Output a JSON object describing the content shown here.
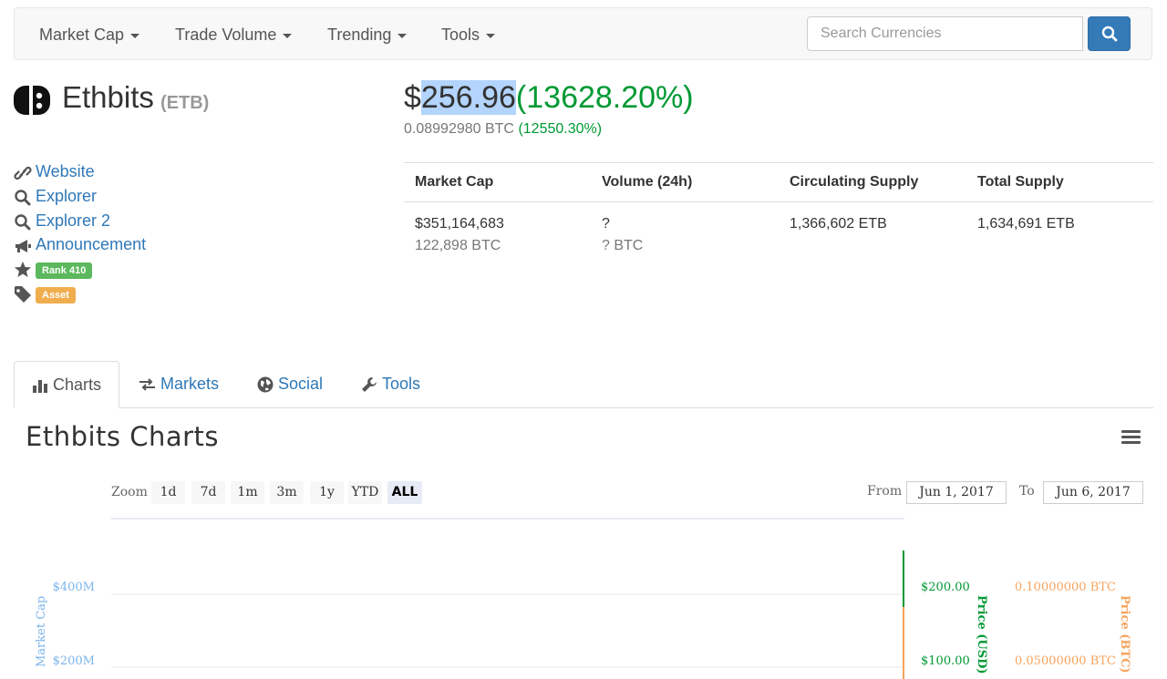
{
  "nav": {
    "items": [
      {
        "label": "Market Cap"
      },
      {
        "label": "Trade Volume"
      },
      {
        "label": "Trending"
      },
      {
        "label": "Tools"
      }
    ],
    "search_placeholder": "Search Currencies"
  },
  "coin": {
    "name": "Ethbits",
    "symbol": "(ETB)",
    "price_currency": "$",
    "price_usd": "256.96",
    "price_change": "(13628.20%)",
    "price_btc": "0.08992980 BTC",
    "price_btc_change": "(12550.30%)"
  },
  "links": [
    {
      "icon": "link-icon",
      "label": "Website"
    },
    {
      "icon": "search-icon",
      "label": "Explorer"
    },
    {
      "icon": "search-icon",
      "label": "Explorer 2"
    },
    {
      "icon": "bullhorn-icon",
      "label": "Announcement"
    }
  ],
  "badges": {
    "rank": {
      "icon": "star-icon",
      "label": "Rank 410",
      "color": "#5cb85c"
    },
    "type": {
      "icon": "tag-icon",
      "label": "Asset",
      "color": "#f0ad4e"
    }
  },
  "stats": {
    "headers": [
      "Market Cap",
      "Volume (24h)",
      "Circulating Supply",
      "Total Supply"
    ],
    "row1": [
      "$351,164,683",
      "?",
      "1,366,602 ETB",
      "1,634,691 ETB"
    ],
    "row2": [
      "122,898 BTC",
      "? BTC",
      "",
      ""
    ]
  },
  "tabs": [
    {
      "icon": "bar-chart-icon",
      "label": "Charts",
      "active": true
    },
    {
      "icon": "exchange-icon",
      "label": "Markets",
      "active": false
    },
    {
      "icon": "globe-icon",
      "label": "Social",
      "active": false
    },
    {
      "icon": "wrench-icon",
      "label": "Tools",
      "active": false
    }
  ],
  "chart": {
    "title": "Ethbits Charts",
    "zoom_label": "Zoom",
    "zoom_options": [
      "1d",
      "7d",
      "1m",
      "3m",
      "1y",
      "YTD",
      "ALL"
    ],
    "zoom_active": "ALL",
    "from_label": "From",
    "from_date": "Jun 1, 2017",
    "to_label": "To",
    "to_date": "Jun 6, 2017"
  },
  "chart_data": {
    "type": "line",
    "y_left": {
      "label": "Market Cap",
      "ticks": [
        "$400M",
        "$200M"
      ],
      "color": "#7cb5ec"
    },
    "y_right1": {
      "label": "Price (USD)",
      "ticks": [
        "$200.00",
        "$100.00"
      ],
      "color": "#009933"
    },
    "y_right2": {
      "label": "Price (BTC)",
      "ticks": [
        "0.10000000 BTC",
        "0.05000000 BTC"
      ],
      "color": "#f7a35c"
    }
  }
}
